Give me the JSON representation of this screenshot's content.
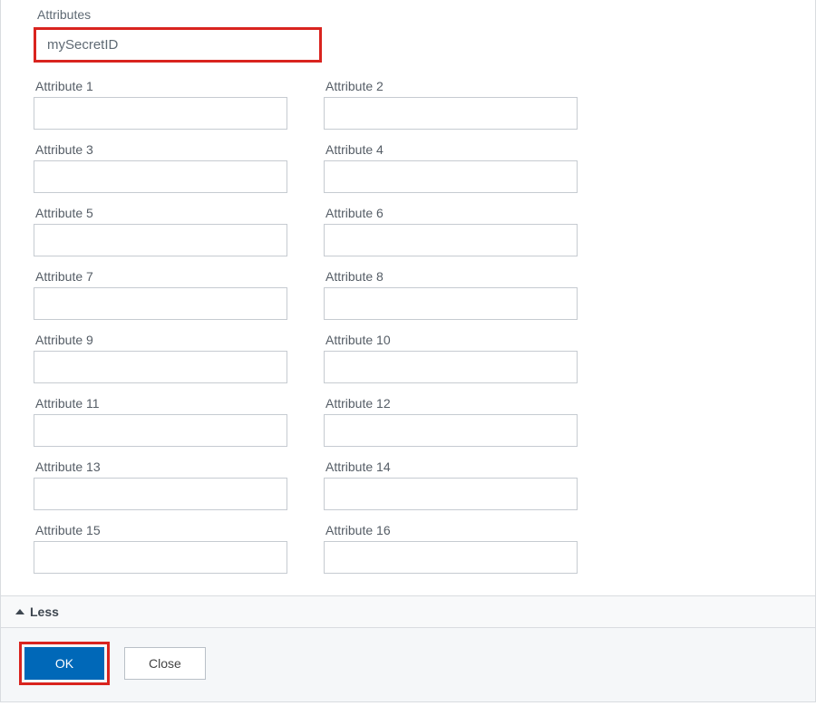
{
  "section_label": "Attributes",
  "main_value": "mySecretID",
  "attributes": [
    {
      "label": "Attribute 1",
      "value": ""
    },
    {
      "label": "Attribute 2",
      "value": ""
    },
    {
      "label": "Attribute 3",
      "value": ""
    },
    {
      "label": "Attribute 4",
      "value": ""
    },
    {
      "label": "Attribute 5",
      "value": ""
    },
    {
      "label": "Attribute 6",
      "value": ""
    },
    {
      "label": "Attribute 7",
      "value": ""
    },
    {
      "label": "Attribute 8",
      "value": ""
    },
    {
      "label": "Attribute 9",
      "value": ""
    },
    {
      "label": "Attribute 10",
      "value": ""
    },
    {
      "label": "Attribute 11",
      "value": ""
    },
    {
      "label": "Attribute 12",
      "value": ""
    },
    {
      "label": "Attribute 13",
      "value": ""
    },
    {
      "label": "Attribute 14",
      "value": ""
    },
    {
      "label": "Attribute 15",
      "value": ""
    },
    {
      "label": "Attribute 16",
      "value": ""
    }
  ],
  "less_label": "Less",
  "buttons": {
    "ok": "OK",
    "close": "Close"
  }
}
